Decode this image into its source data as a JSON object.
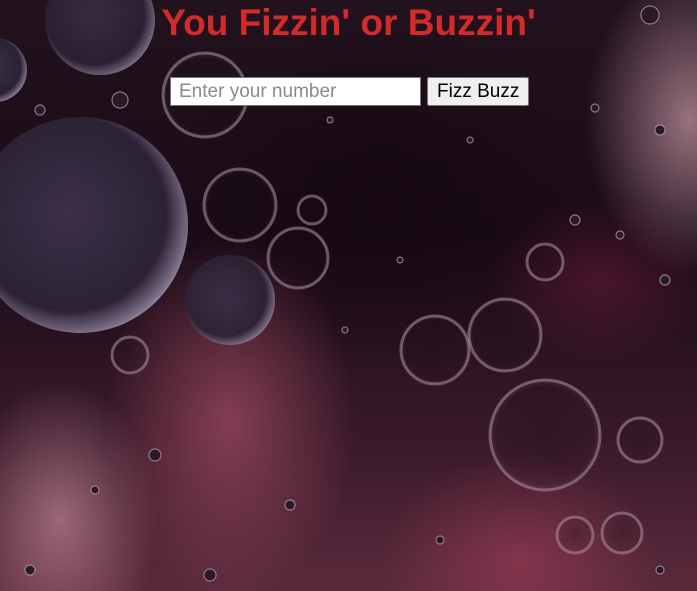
{
  "page": {
    "title": "You Fizzin' or Buzzin'",
    "title_color": "#d42a2a"
  },
  "form": {
    "input_placeholder": "Enter your number",
    "input_value": "",
    "button_label": "Fizz Buzz"
  },
  "background": {
    "image": "bubbles-photo"
  }
}
